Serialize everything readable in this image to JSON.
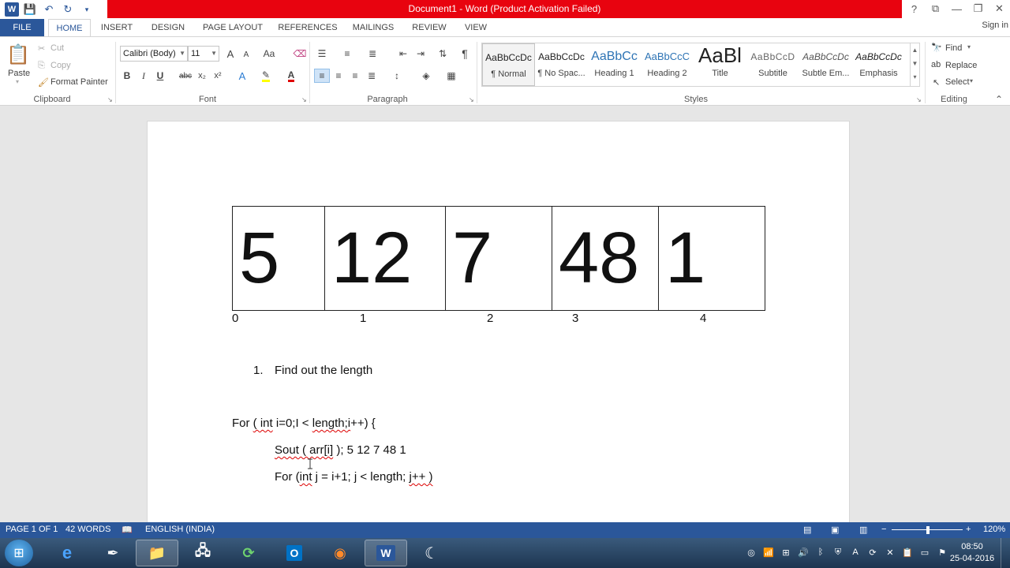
{
  "window": {
    "title": "Document1 - Word (Product Activation Failed)",
    "controls": [
      "?",
      "⧉",
      "—",
      "❐",
      "✕"
    ]
  },
  "tabs": {
    "file": "FILE",
    "home": "HOME",
    "insert": "INSERT",
    "design": "DESIGN",
    "page_layout": "PAGE LAYOUT",
    "references": "REFERENCES",
    "mailings": "MAILINGS",
    "review": "REVIEW",
    "view": "VIEW",
    "sign_in": "Sign in"
  },
  "clipboard": {
    "paste": "Paste",
    "cut": "Cut",
    "copy": "Copy",
    "format_painter": "Format Painter",
    "label": "Clipboard"
  },
  "font": {
    "family": "Calibri (Body)",
    "size": "11",
    "label": "Font",
    "bold": "B",
    "italic": "I",
    "underline": "U",
    "strike": "abc",
    "subscript": "x₂",
    "superscript": "x²",
    "grow": "A",
    "shrink": "A",
    "change_case": "Aa"
  },
  "paragraph": {
    "label": "Paragraph"
  },
  "styles": {
    "label": "Styles",
    "items": [
      {
        "preview": "AaBbCcDc",
        "name": "¶ Normal"
      },
      {
        "preview": "AaBbCcDc",
        "name": "¶ No Spac..."
      },
      {
        "preview": "AaBbCc",
        "name": "Heading 1"
      },
      {
        "preview": "AaBbCcC",
        "name": "Heading 2"
      },
      {
        "preview": "AaBl",
        "name": "Title"
      },
      {
        "preview": "AaBbCcD",
        "name": "Subtitle"
      },
      {
        "preview": "AaBbCcDc",
        "name": "Subtle Em..."
      },
      {
        "preview": "AaBbCcDc",
        "name": "Emphasis"
      }
    ]
  },
  "editing": {
    "find": "Find",
    "replace": "Replace",
    "select": "Select",
    "label": "Editing"
  },
  "document": {
    "array": [
      "5",
      "12",
      "7",
      "48",
      "1"
    ],
    "indices": [
      "0",
      "1",
      "2",
      "3",
      "4"
    ],
    "list_number": "1.",
    "list_text": "Find out the length",
    "code1_pre": "For ",
    "code1_a": "( int",
    "code1_b": " i=0;I < ",
    "code1_c": "length;i",
    "code1_d": "++) {",
    "code2_a": "Sout ( arr[i]",
    "code2_b": " );  5  12  7  48 1",
    "code3_pre": "For (",
    "code3_a": "int",
    "code3_b": " j = i+1; j < length; ",
    "code3_c": "j++ )"
  },
  "status": {
    "page": "PAGE 1 OF 1",
    "words": "42 WORDS",
    "language": "ENGLISH (INDIA)",
    "zoom": "120%"
  },
  "taskbar": {
    "time": "08:50",
    "date": "25-04-2016"
  },
  "colors": {
    "title_red": "#e8030f",
    "word_blue": "#2b579a"
  }
}
